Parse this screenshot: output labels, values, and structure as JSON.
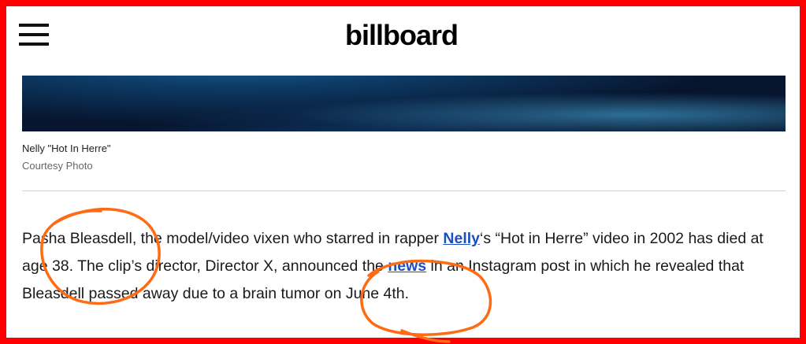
{
  "header": {
    "logo": "billboard",
    "menu_icon": "hamburger-menu-icon"
  },
  "hero": {
    "caption_title": "Nelly \"Hot In Herre\"",
    "caption_credit": "Courtesy Photo"
  },
  "article": {
    "p1_a": "Pasha Bleasdell, the model/video vixen who starred in rapper ",
    "link_nelly": "Nelly",
    "p1_b": "‘s “Hot in Herre” video in 2002 has died at age 38. The clip’s director, Director X, announced the ",
    "link_news": "news",
    "p1_c": " in an Instagram post in which he revealed that Bleasdell passed away due to a brain tumor on June 4th."
  },
  "colors": {
    "frame_border": "#ff0000",
    "annotation": "#ff6a13",
    "link": "#1a4fc2"
  }
}
